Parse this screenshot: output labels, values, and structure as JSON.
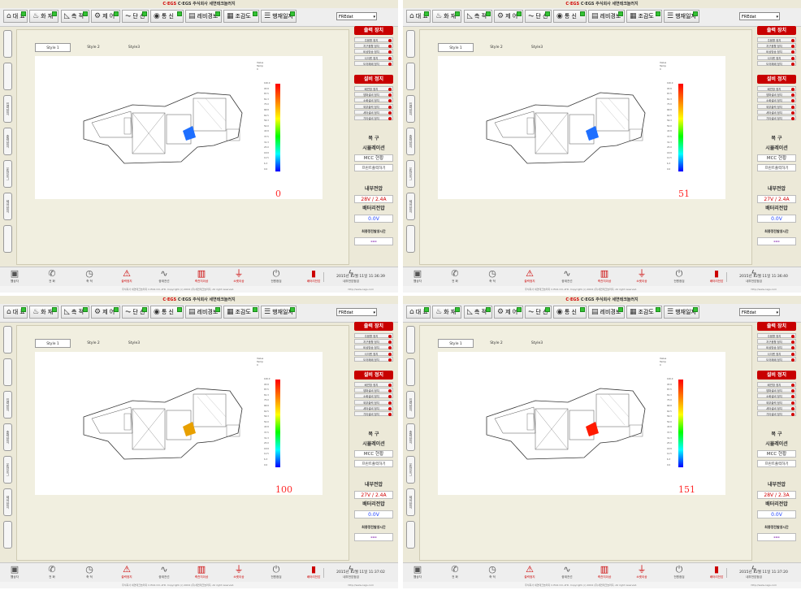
{
  "brand": "C·EGS 주식회사 세연테크놀러지",
  "menu": [
    {
      "icon": "home-icon",
      "glyph": "⌂",
      "label": "대 표"
    },
    {
      "icon": "fire-icon",
      "glyph": "♨",
      "label": "화 재"
    },
    {
      "icon": "measure-icon",
      "glyph": "◺",
      "label": "측 적"
    },
    {
      "icon": "control-icon",
      "glyph": "⚙",
      "label": "제 어"
    },
    {
      "icon": "circuit-icon",
      "glyph": "⏦",
      "label": "단 선"
    },
    {
      "icon": "signal-icon",
      "glyph": "◉",
      "label": "통 신"
    },
    {
      "icon": "chart-icon",
      "glyph": "▤",
      "label": "레비경보"
    },
    {
      "icon": "view-icon",
      "glyph": "▦",
      "label": "조감도"
    },
    {
      "icon": "log-icon",
      "glyph": "☰",
      "label": "행재일지"
    }
  ],
  "select_value": "FREdat",
  "left_tabs": [
    "",
    "",
    "입력장치",
    "출력장치",
    "운전로그",
    "제어장치",
    ""
  ],
  "style_tabs": [
    "Style 1",
    "Style 2",
    "Style3"
  ],
  "scale": {
    "header": "Value\nTemp\nC",
    "ticks": [
      "100.0",
      "93.8",
      "87.5",
      "81.3",
      "75.0",
      "68.8",
      "62.5",
      "56.3",
      "50.0",
      "43.8",
      "37.5",
      "31.3",
      "25.0",
      "18.8",
      "12.5",
      "6.3",
      "0.0"
    ]
  },
  "right_panel": {
    "header1": "출력 장치",
    "buttons1": [
      "주음향 정지",
      "지구음향 정지",
      "비상방송 정지",
      "사이렌 정지",
      "도어폐쇄 정지"
    ],
    "header2": "설비 정지",
    "buttons2": [
      "배연창 정지",
      "댐퍼설비 정지",
      "소화설비 정지",
      "외부출력 정지",
      "셔터설비 정지",
      "기타설비 정지"
    ],
    "restore": "복   구",
    "simulation": "시뮬레이션",
    "mcc": "MCC 현황",
    "print": "프린트출력하기",
    "internal_voltage": "내부전압",
    "battery_voltage": "배터리전압",
    "last_time": "최종정전발생시간"
  },
  "bottom_icons": [
    {
      "icon": "pc-icon",
      "glyph": "▣",
      "label": "웹상자",
      "red": false
    },
    {
      "icon": "phone-icon",
      "glyph": "✆",
      "label": "전 화",
      "red": false
    },
    {
      "icon": "clock-icon",
      "glyph": "◷",
      "label": "축 적",
      "red": false
    },
    {
      "icon": "alarm-icon",
      "glyph": "⚠",
      "label": "출력정지",
      "red": true
    },
    {
      "icon": "pulse-icon",
      "glyph": "∿",
      "label": "중계전선",
      "red": false
    },
    {
      "icon": "trash-icon",
      "glyph": "▥",
      "label": "축전지이상",
      "red": true
    },
    {
      "icon": "plug-icon",
      "glyph": "⏚",
      "label": "소켓이상",
      "red": true
    },
    {
      "icon": "power-icon",
      "glyph": "⏻",
      "label": "전원점검",
      "red": false
    },
    {
      "icon": "battery-icon",
      "glyph": "▮",
      "label": "배터리전압",
      "red": true
    },
    {
      "icon": "volt-icon",
      "glyph": "ϟ",
      "label": "내부전압점검",
      "red": false
    }
  ],
  "copyright": "주식회사 세연테크놀러지 C·EGS CO.,LTD. Copyright (c) 2004 (주)세연테크놀러지. All right reserved.",
  "url": "http://www.cegs.com",
  "screens": [
    {
      "value": "0",
      "internal": "28V / 2.4A",
      "battery": "0.0V",
      "time": "2015년 12월 11일 11:36:39",
      "hotspot": "#1e6fff"
    },
    {
      "value": "51",
      "internal": "27V / 2.4A",
      "battery": "0.0V",
      "time": "2015년 12월 11일 11:36:40",
      "hotspot": "#1e6fff"
    },
    {
      "value": "100",
      "internal": "27V / 2.4A",
      "battery": "0.0V",
      "time": "2015년 12월 11일 11:37:02",
      "hotspot": "#e8a000"
    },
    {
      "value": "151",
      "internal": "28V / 2.3A",
      "battery": "0.0V",
      "time": "2015년 12월 11일 11:37:20",
      "hotspot": "#ff1a00"
    }
  ]
}
